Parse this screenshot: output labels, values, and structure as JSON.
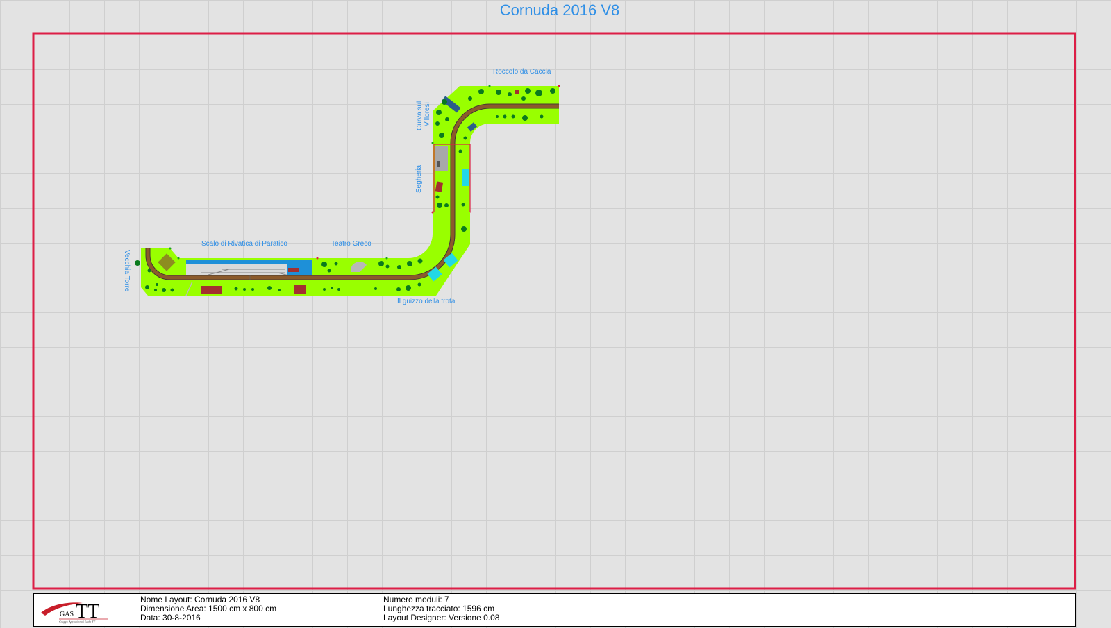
{
  "title": "Cornuda 2016 V8",
  "labels": {
    "roccolo": "Roccolo da Caccia",
    "curva_line1": "Curva sul",
    "curva_line2": "Villoresi",
    "segheria": "Segheria",
    "scalo": "Scalo di Rivatica di Paratico",
    "teatro": "Teatro Greco",
    "vecchia": "Vecchia Torre",
    "guizzo": "Il guizzo della trota"
  },
  "info": {
    "nome_layout": "Nome Layout: Cornuda 2016 V8",
    "dimensione": "Dimensione Area: 1500 cm x 800 cm",
    "data": "Data: 30-8-2016",
    "numero_moduli": "Numero moduli: 7",
    "lunghezza": "Lunghezza tracciato: 1596 cm",
    "designer": "Layout Designer: Versione 0.08"
  },
  "logo": {
    "short": "GAS",
    "big": "TT",
    "subtitle": "Gruppo Appassionati Scala TT"
  },
  "colors": {
    "area_border": "#dc1e46",
    "grass": "#99ff00",
    "track": "#8b5a2b",
    "label": "#2f8fe6",
    "tree": "#0a7a1e"
  }
}
